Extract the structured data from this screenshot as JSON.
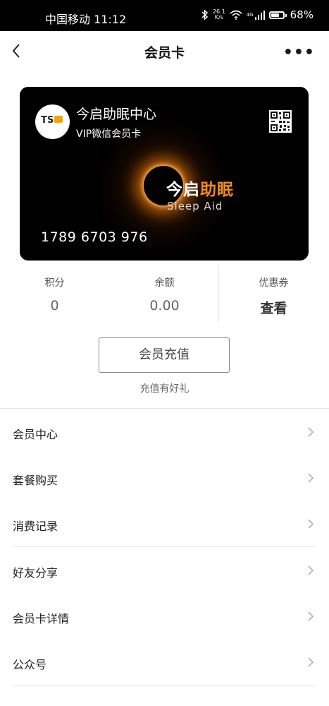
{
  "status_bar": {
    "carrier": "中国移动",
    "time": "11:12",
    "net_speed_value": "26.1",
    "net_speed_unit": "K/s",
    "signal_type": "4G",
    "battery_percent": "68%",
    "battery_level": 0.68
  },
  "nav": {
    "title": "会员卡",
    "more_label": "•••"
  },
  "card": {
    "store_name": "今启助眠中心",
    "card_type": "VIP微信会员卡",
    "logo_text": "TS",
    "brand_white": "今启",
    "brand_orange": "助眠",
    "brand_en": "Sleep Aid",
    "card_number": "1789 6703 976",
    "accent_color": "#f08c1e"
  },
  "stats": [
    {
      "label": "积分",
      "value": "0"
    },
    {
      "label": "余额",
      "value": "0.00"
    },
    {
      "label": "优惠券",
      "value": "查看"
    }
  ],
  "recharge": {
    "button_label": "会员充值",
    "subtitle": "充值有好礼"
  },
  "menu": [
    {
      "label": "会员中心"
    },
    {
      "label": "套餐购买"
    },
    {
      "label": "消费记录"
    },
    {
      "label": "好友分享"
    },
    {
      "label": "会员卡详情"
    },
    {
      "label": "公众号"
    }
  ]
}
